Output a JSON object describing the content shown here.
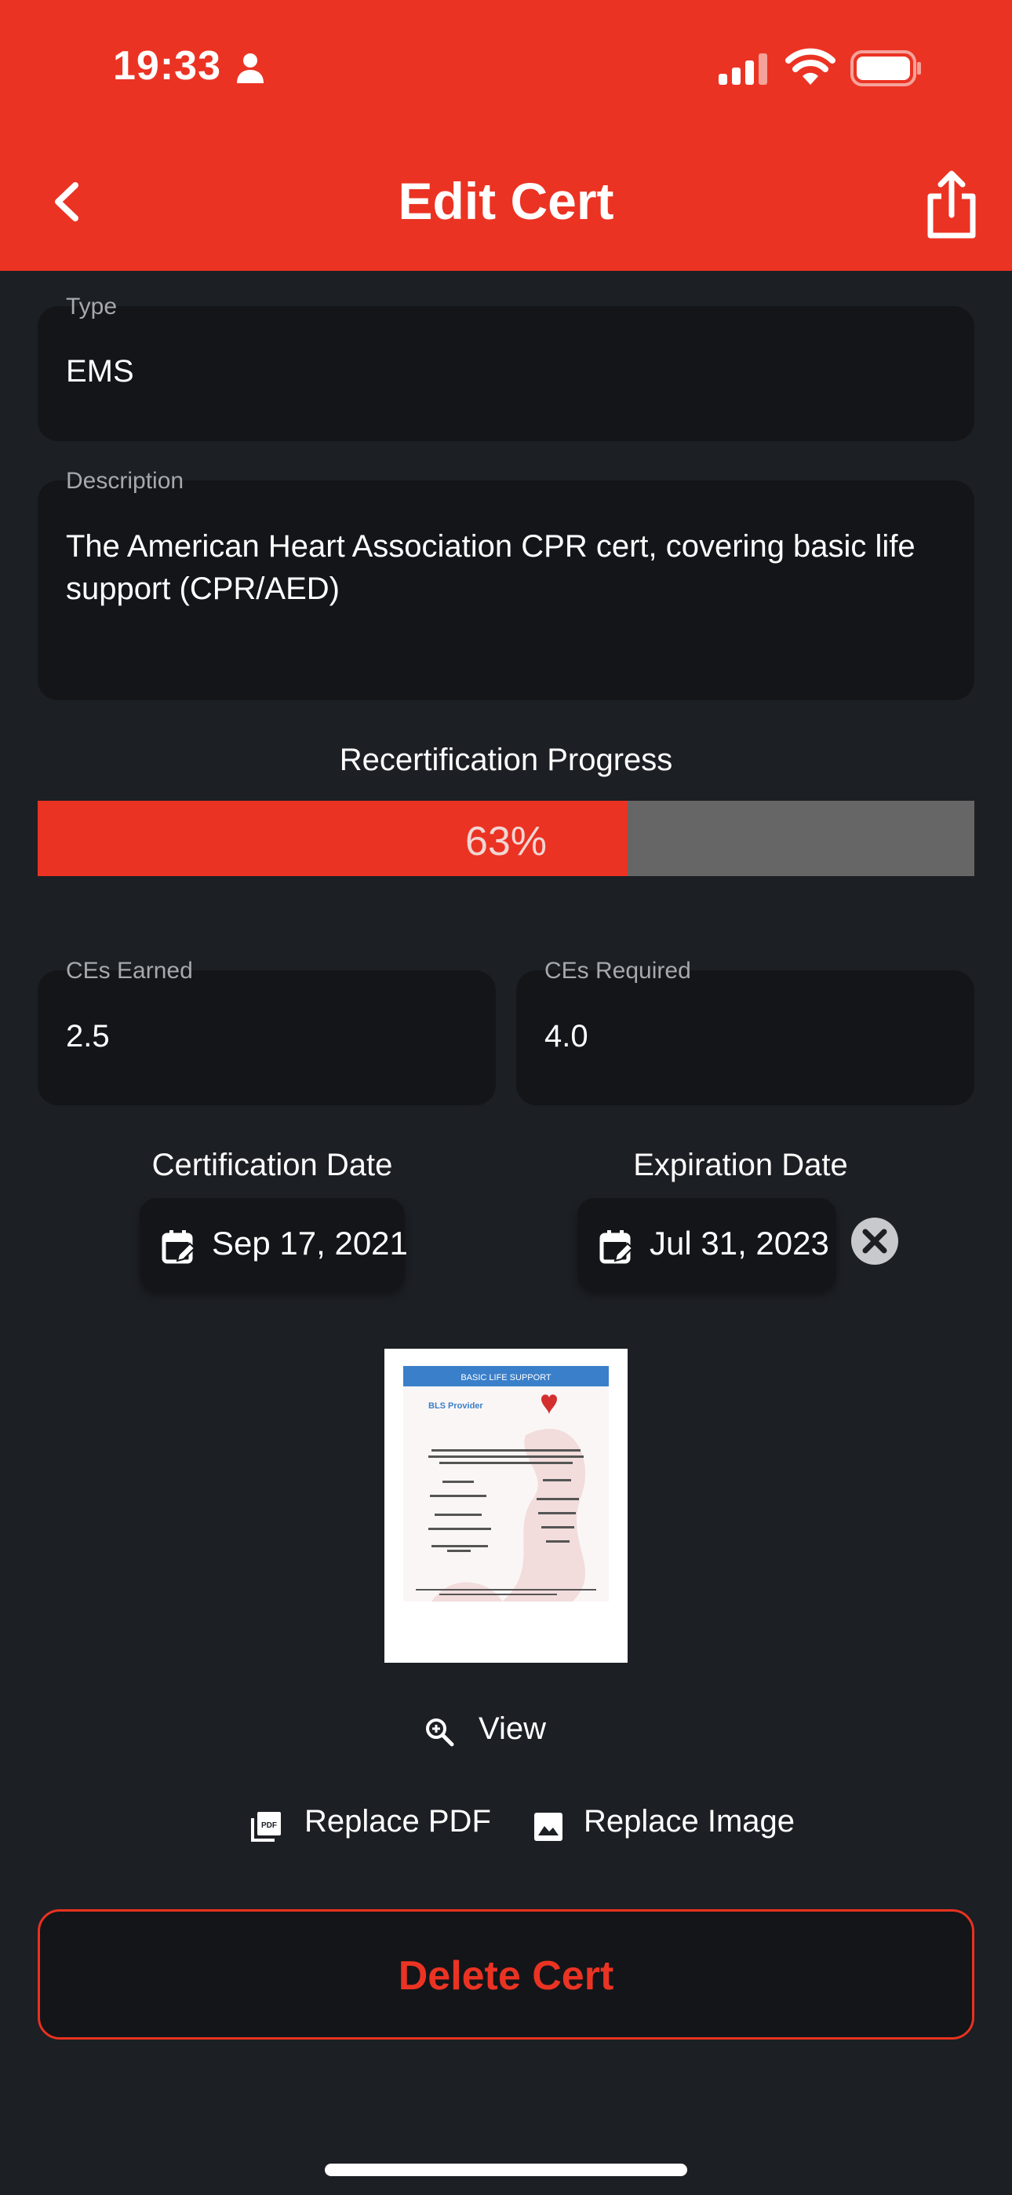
{
  "status_bar": {
    "time": "19:33"
  },
  "header": {
    "title": "Edit Cert"
  },
  "type_field": {
    "label": "Type",
    "value": "EMS"
  },
  "description_field": {
    "label": "Description",
    "value": "The American Heart Association CPR cert, covering basic life support (CPR/AED)"
  },
  "progress": {
    "title": "Recertification Progress",
    "label": "63%",
    "value": 0.63
  },
  "ces_earned": {
    "label": "CEs Earned",
    "value": "2.5"
  },
  "ces_required": {
    "label": "CEs Required",
    "value": "4.0"
  },
  "certification_date": {
    "label": "Certification Date",
    "value": "Sep 17, 2021"
  },
  "expiration_date": {
    "label": "Expiration Date",
    "value": "Jul 31, 2023"
  },
  "certificate_image": {
    "header": "BASIC LIFE SUPPORT",
    "program": "BLS Provider",
    "org": "American Heart Association"
  },
  "actions": {
    "view": "View",
    "replace_pdf": "Replace PDF",
    "replace_image": "Replace Image",
    "delete": "Delete Cert"
  },
  "colors": {
    "accent": "#eb3323",
    "background": "#1c1f24",
    "field": "#131519",
    "track": "#666666"
  },
  "icons": [
    "person-icon",
    "signal-icon",
    "wifi-icon",
    "battery-icon",
    "back-chevron-icon",
    "share-icon",
    "calendar-edit-icon",
    "clear-icon",
    "zoom-in-icon",
    "pdf-icon",
    "image-icon"
  ]
}
